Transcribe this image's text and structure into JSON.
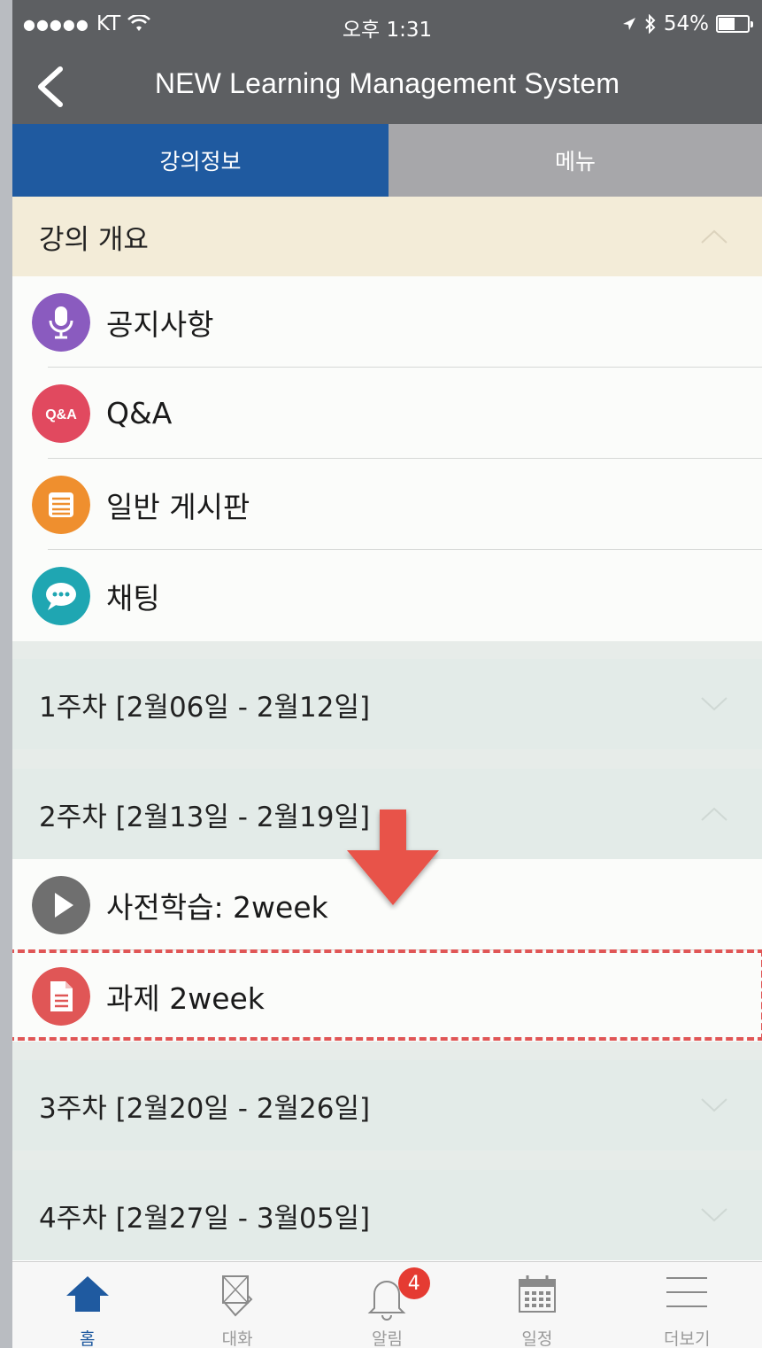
{
  "status_bar": {
    "carrier": "KT",
    "time": "오후 1:31",
    "battery": "54%",
    "battery_level": 0.54
  },
  "header": {
    "title": "NEW Learning Management System"
  },
  "tabs": [
    {
      "label": "강의정보",
      "active": true
    },
    {
      "label": "메뉴",
      "active": false
    }
  ],
  "overview": {
    "title": "강의 개요",
    "items": [
      {
        "label": "공지사항",
        "icon": "microphone-icon",
        "color": "#8a5bbf"
      },
      {
        "label": "Q&A",
        "icon": "qa-icon",
        "icon_text": "Q&A",
        "color": "#e1495f"
      },
      {
        "label": "일반 게시판",
        "icon": "list-icon",
        "color": "#ef8f2e"
      },
      {
        "label": "채팅",
        "icon": "chat-icon",
        "color": "#1fa6b2"
      }
    ]
  },
  "weeks": [
    {
      "title": "1주차 [2월06일 - 2월12일]",
      "expanded": false
    },
    {
      "title": "2주차 [2월13일 - 2월19일]",
      "expanded": true,
      "items": [
        {
          "label": "사전학습: 2week",
          "icon": "play-icon",
          "color": "#6f6f6f"
        },
        {
          "label": "과제 2week",
          "icon": "document-icon",
          "color": "#e05656"
        }
      ]
    },
    {
      "title": "3주차 [2월20일 - 2월26일]",
      "expanded": false
    },
    {
      "title": "4주차 [2월27일 - 3월05일]",
      "expanded": false
    }
  ],
  "bottom_nav": [
    {
      "label": "홈",
      "icon": "home-icon",
      "active": true
    },
    {
      "label": "대화",
      "icon": "conversation-icon",
      "active": false
    },
    {
      "label": "알림",
      "icon": "bell-icon",
      "active": false,
      "badge": "4"
    },
    {
      "label": "일정",
      "icon": "calendar-icon",
      "active": false
    },
    {
      "label": "더보기",
      "icon": "menu-icon",
      "active": false
    }
  ],
  "colors": {
    "header_bg": "#5d5f62",
    "tab_active": "#1f5aa0",
    "tab_inactive": "#a7a7aa",
    "overview_bg": "#f3ecd8",
    "week_bg": "#e3ebe8",
    "highlight": "#e05656"
  }
}
